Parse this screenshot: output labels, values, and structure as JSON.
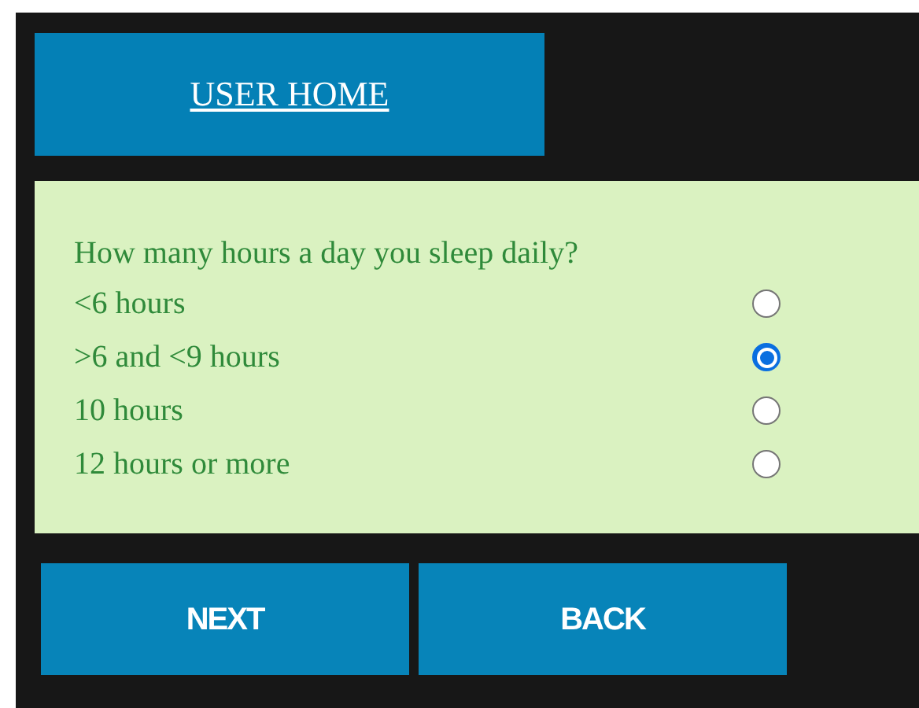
{
  "nav": {
    "home_link": "USER HOME"
  },
  "question": "How many hours a day you sleep daily?",
  "options": [
    {
      "label": "<6 hours",
      "selected": false
    },
    {
      "label": ">6 and <9 hours",
      "selected": true
    },
    {
      "label": "10 hours",
      "selected": false
    },
    {
      "label": "12 hours or more",
      "selected": false
    }
  ],
  "buttons": [
    "NEXT",
    "BACK"
  ]
}
